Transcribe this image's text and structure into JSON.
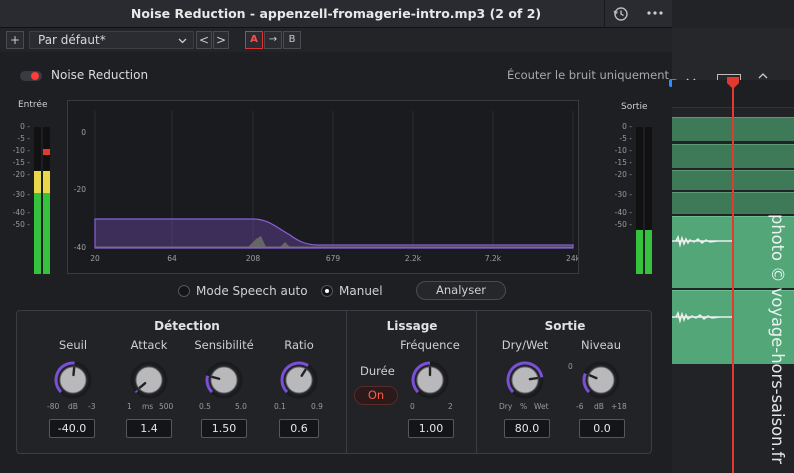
{
  "title": "Noise Reduction - appenzell-fromagerie-intro.mp3 (2 of 2)",
  "preset": {
    "name": "Par défaut*",
    "prev": "<",
    "next": ">",
    "a": "A",
    "copy": "→",
    "b": "B",
    "add": "+"
  },
  "header": {
    "toggle_label": "Noise Reduction",
    "listen_noise_label": "Écouter le bruit uniquement"
  },
  "input_meter": {
    "label": "Entrée",
    "scale": [
      "0",
      "-5",
      "-10",
      "-15",
      "-20",
      "-30",
      "-40",
      "-50"
    ],
    "level_db": -21,
    "peak_db": -9
  },
  "output_meter": {
    "label": "Sortie",
    "scale": [
      "0",
      "-5",
      "-10",
      "-15",
      "-20",
      "-30",
      "-40",
      "-50"
    ],
    "level_db": -42
  },
  "spectrum": {
    "y_ticks": [
      "0",
      "-20",
      "-40"
    ],
    "x_ticks": [
      "20",
      "64",
      "208",
      "679",
      "2.2k",
      "7.2k",
      "24k"
    ]
  },
  "mode": {
    "speech_auto": "Mode Speech auto",
    "manual": "Manuel",
    "selected": "manual",
    "analyze": "Analyser"
  },
  "detection": {
    "title": "Détection",
    "threshold": {
      "label": "Seuil",
      "min": "-80",
      "unit": "dB",
      "max": "-3",
      "value": "-40.0",
      "fraction": 0.52
    },
    "attack": {
      "label": "Attack",
      "min": "1",
      "unit": "ms",
      "max": "500",
      "value": "1.4",
      "fraction": 0.02
    },
    "sensitivity": {
      "label": "Sensibilité",
      "min": "0.5",
      "max": "5.0",
      "value": "1.50",
      "fraction": 0.22
    },
    "ratio": {
      "label": "Ratio",
      "min": "0.1",
      "max": "0.9",
      "value": "0.6",
      "fraction": 0.62
    }
  },
  "smoothing": {
    "title": "Lissage",
    "duration_label": "Durée",
    "duration_state": "On",
    "frequency": {
      "label": "Fréquence",
      "min": "0",
      "max": "2",
      "value": "1.00",
      "fraction": 0.5
    }
  },
  "output": {
    "title": "Sortie",
    "drywet": {
      "label": "Dry/Wet",
      "min": "Dry",
      "unit": "%",
      "max": "Wet",
      "value": "80.0",
      "fraction": 0.8
    },
    "level": {
      "label": "Niveau",
      "zero": "0",
      "min": "-6",
      "unit": "dB",
      "max": "+18",
      "value": "0.0",
      "fraction": 0.25
    }
  },
  "watermark": "photo © voyage-hors-saison.fr",
  "colors": {
    "accent": "#7b4fd6",
    "record_red": "#ff3b3b",
    "meter_green": "#35c23c",
    "clip_green": "#3f7a58"
  }
}
